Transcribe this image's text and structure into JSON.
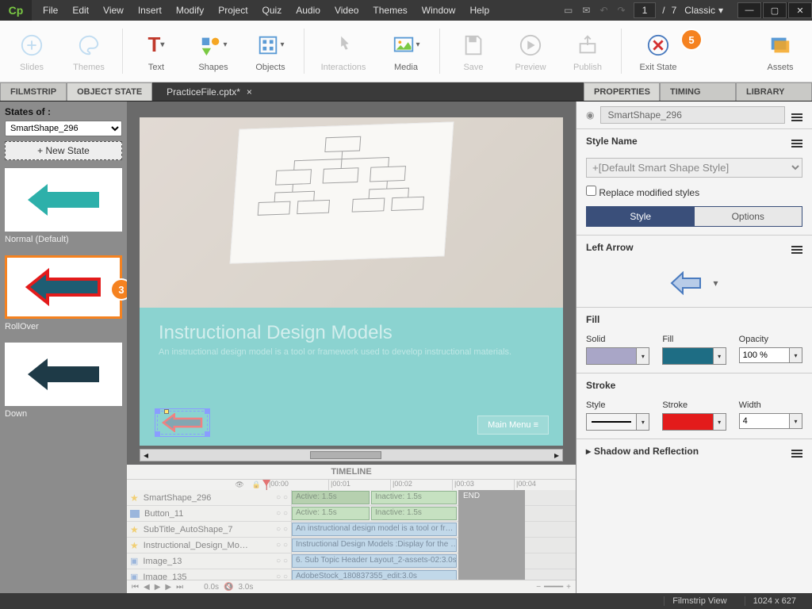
{
  "menubar": [
    "File",
    "Edit",
    "View",
    "Insert",
    "Modify",
    "Project",
    "Quiz",
    "Audio",
    "Video",
    "Themes",
    "Window",
    "Help"
  ],
  "page": {
    "current": "1",
    "total": "7"
  },
  "workspace": "Classic",
  "ribbon": {
    "slides": "Slides",
    "themes": "Themes",
    "text": "Text",
    "shapes": "Shapes",
    "objects": "Objects",
    "interactions": "Interactions",
    "media": "Media",
    "save": "Save",
    "preview": "Preview",
    "publish": "Publish",
    "exit_state": "Exit State",
    "assets": "Assets"
  },
  "callouts": {
    "exit_state": "5",
    "rollover": "3"
  },
  "tabs": {
    "filmstrip": "FILMSTRIP",
    "object_state": "OBJECT STATE",
    "file": "PracticeFile.cptx*",
    "close": "×",
    "properties": "PROPERTIES",
    "timing": "TIMING",
    "library": "LIBRARY"
  },
  "states_panel": {
    "heading": "States of :",
    "object": "SmartShape_296",
    "new_state": "+ New State",
    "thumbs": [
      {
        "label": "Normal (Default)",
        "fill": "#2db0aa",
        "stroke": "#2db0aa"
      },
      {
        "label": "RollOver",
        "fill": "#1e5d73",
        "stroke": "#e31b1b"
      },
      {
        "label": "Down",
        "fill": "#1e3a47",
        "stroke": "#1e3a47"
      }
    ]
  },
  "stage": {
    "title": "Instructional Design Models",
    "subtitle": "An instructional design model is a tool or framework used to develop instructional materials.",
    "main_menu": "Main Menu"
  },
  "timeline": {
    "title": "TIMELINE",
    "ticks": [
      "|00:00",
      "|00:01",
      "|00:02",
      "|00:03",
      "|00:04"
    ],
    "rows": [
      {
        "icon": "star",
        "name": "SmartShape_296",
        "clip": "Active: 1.5s",
        "clip2": "Inactive: 1.5s",
        "sel": true
      },
      {
        "icon": "blue",
        "name": "Button_11",
        "clip": "Active: 1.5s",
        "clip2": "Inactive: 1.5s"
      },
      {
        "icon": "star",
        "name": "SubTitle_AutoShape_7",
        "clip": "An instructional design model is a tool or fr…",
        "blue": true
      },
      {
        "icon": "star",
        "name": "Instructional_Design_Mo…",
        "clip": "Instructional Design Models :Display for the …",
        "blue": true
      },
      {
        "icon": "img",
        "name": "Image_13",
        "clip": "6. Sub Topic Header Layout_2-assets-02:3.0s",
        "blue": true
      },
      {
        "icon": "img",
        "name": "Image_135",
        "clip": "AdobeStock_180837355_edit:3.0s",
        "blue": true
      }
    ],
    "end": "END",
    "foot_time": "0.0s",
    "foot_total": "3.0s"
  },
  "properties": {
    "object_name": "SmartShape_296",
    "style_name_label": "Style Name",
    "style_name": "+[Default Smart Shape Style]",
    "replace": "Replace modified styles",
    "tab_style": "Style",
    "tab_options": "Options",
    "shape_label": "Left Arrow",
    "fill_section": "Fill",
    "fill": {
      "solid_label": "Solid",
      "solid_color": "#a9a6c7",
      "fill_label": "Fill",
      "fill_color": "#1e6d84",
      "opacity_label": "Opacity",
      "opacity": "100 %"
    },
    "stroke_section": "Stroke",
    "stroke": {
      "style_label": "Style",
      "stroke_label": "Stroke",
      "stroke_color": "#e31b1b",
      "width_label": "Width",
      "width": "4"
    },
    "shadow_section": "Shadow and Reflection"
  },
  "status": {
    "view": "Filmstrip View",
    "dims": "1024 x 627"
  }
}
